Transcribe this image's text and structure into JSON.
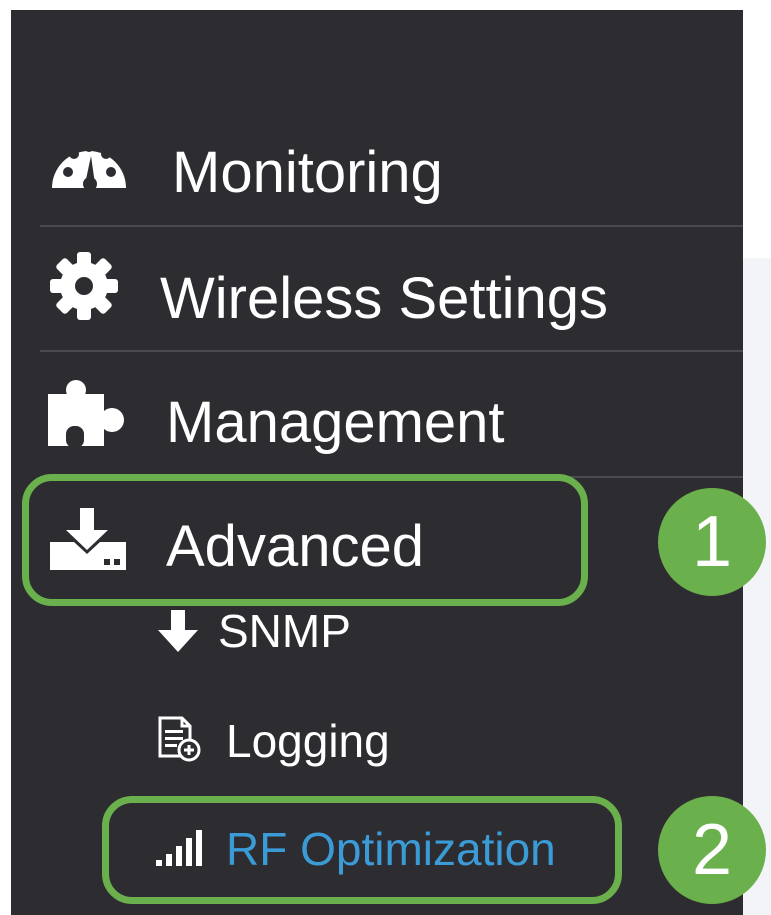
{
  "nav": {
    "items": [
      {
        "label": "Monitoring",
        "icon": "dashboard-gauge-icon"
      },
      {
        "label": "Wireless Settings",
        "icon": "gear-icon"
      },
      {
        "label": "Management",
        "icon": "puzzle-piece-icon"
      },
      {
        "label": "Advanced",
        "icon": "download-tray-icon"
      }
    ],
    "subitems": [
      {
        "label": "SNMP",
        "icon": "arrow-down-icon"
      },
      {
        "label": "Logging",
        "icon": "log-document-icon"
      },
      {
        "label": "RF Optimization",
        "icon": "signal-bars-icon",
        "active": true
      }
    ]
  },
  "annotations": {
    "step1": "1",
    "step2": "2"
  },
  "colors": {
    "sidebar_bg": "#2d2c30",
    "active_text": "#3a9bd6",
    "highlight": "#6ab04c"
  }
}
